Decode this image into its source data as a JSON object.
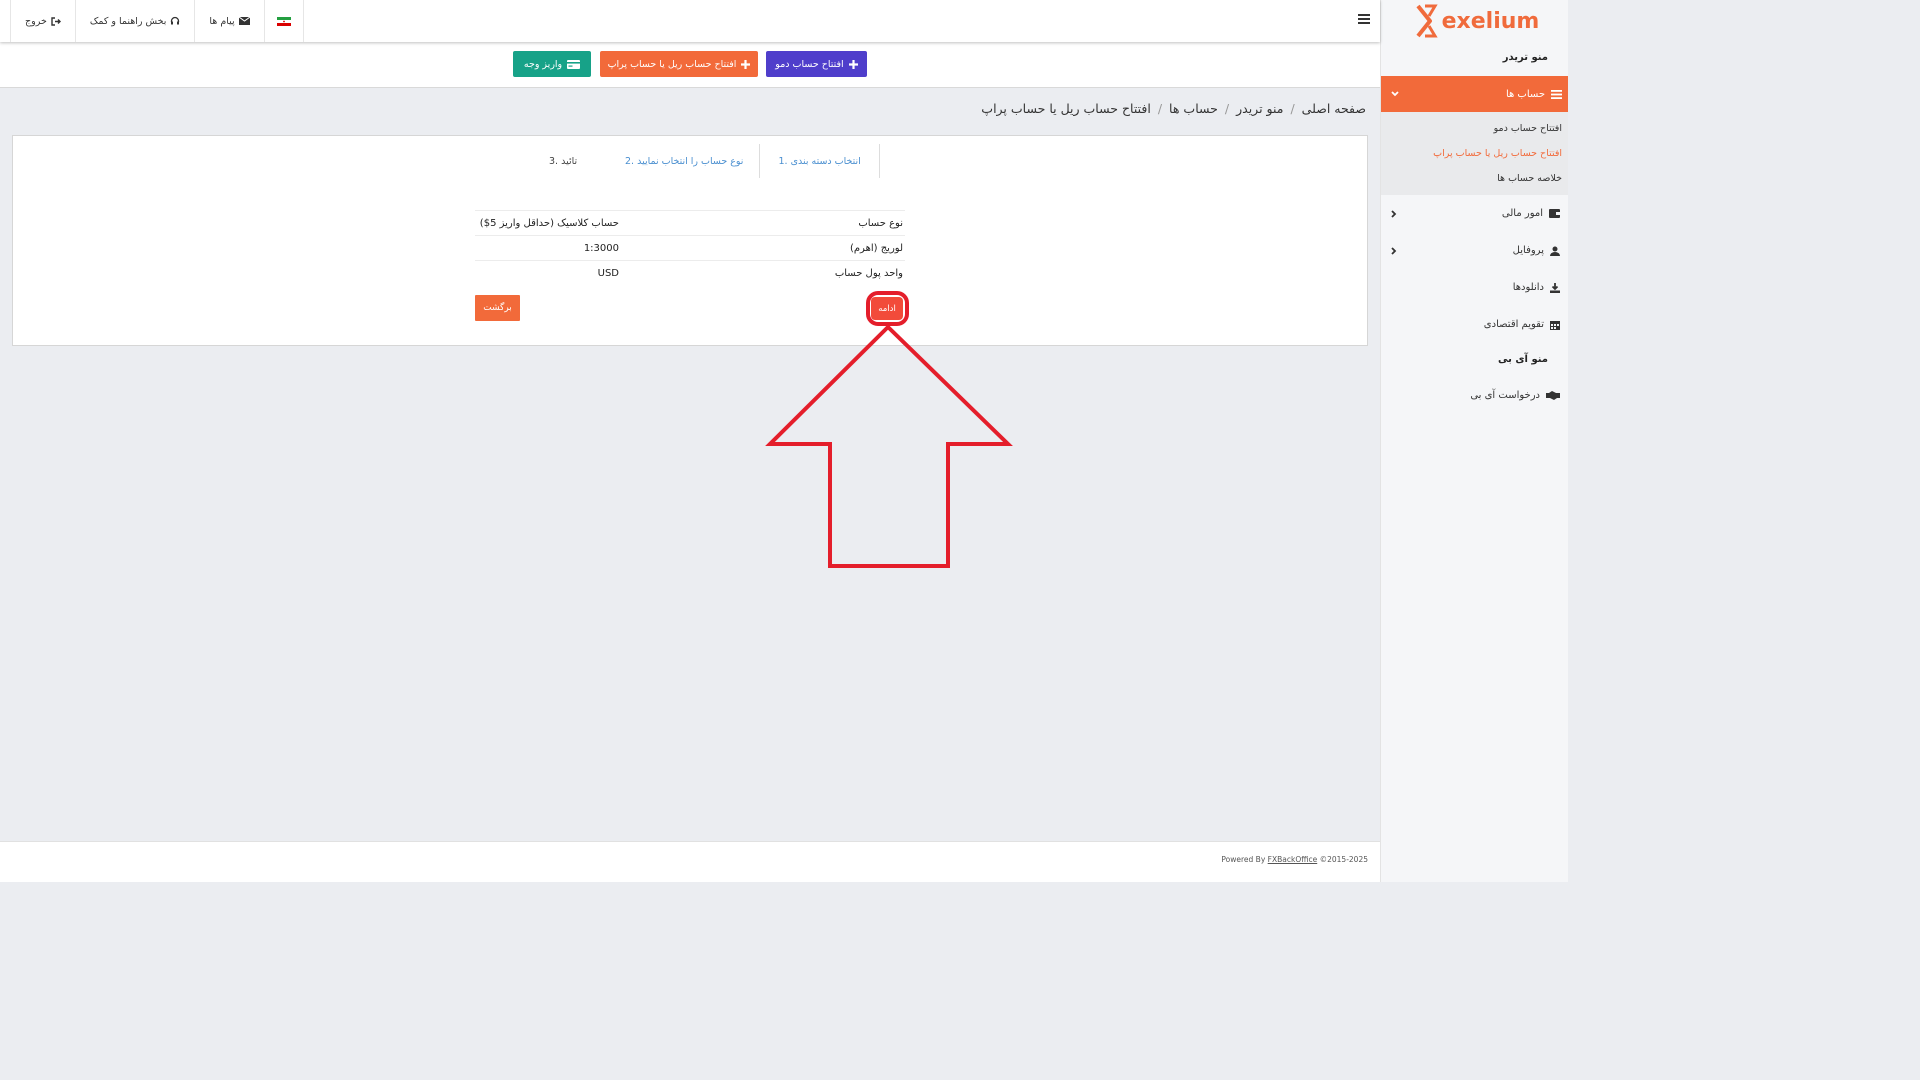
{
  "brand": {
    "name": "exelium",
    "color": "#f06b3c"
  },
  "topbar": {
    "logout": "خروج",
    "help": "بخش راهنما و کمک",
    "messages": "پیام ها",
    "language_flag": "iran-flag-icon"
  },
  "actions": {
    "demo": "افتتاح حساب دمو",
    "real": "افتتاح حساب ریل یا حساب پراپ",
    "deposit": "واریز وجه"
  },
  "breadcrumb": [
    "صفحه اصلی",
    "منو تریدر",
    "حساب ها",
    "افتتاح حساب ریل یا حساب پراپ"
  ],
  "sidebar": {
    "trader_menu": "منو تریدر",
    "accounts": "حساب ها",
    "sub_items": [
      "افتتاح حساب دمو",
      "افتتاح حساب ریل یا حساب پراپ",
      "خلاصه حساب ها"
    ],
    "financial": "امور مالی",
    "profile": "پروفایل",
    "downloads": "دانلودها",
    "calendar": "تقویم اقتصادی",
    "ib_menu": "منو آی بی",
    "ib_request": "درخواست آی بی"
  },
  "steps": [
    "1. انتخاب دسته بندی",
    "2. نوع حساب را انتخاب نمایید",
    "3. تائید"
  ],
  "summary": [
    {
      "key": "نوع حساب",
      "value": "حساب کلاسیک (حداقل واریز 5$)"
    },
    {
      "key": "لوریج (اهرم)",
      "value": "1:3000"
    },
    {
      "key": "واحد پول حساب",
      "value": "USD"
    }
  ],
  "buttons": {
    "back": "برگشت",
    "continue": "ادامه"
  },
  "footer": {
    "powered": "Powered By",
    "link": "FXBackOffice",
    "copyright": "©2015-2025"
  },
  "colors": {
    "accent": "#f26a3a",
    "demo": "#4f3ecb",
    "deposit": "#17a288",
    "highlight": "#e41e2b"
  }
}
